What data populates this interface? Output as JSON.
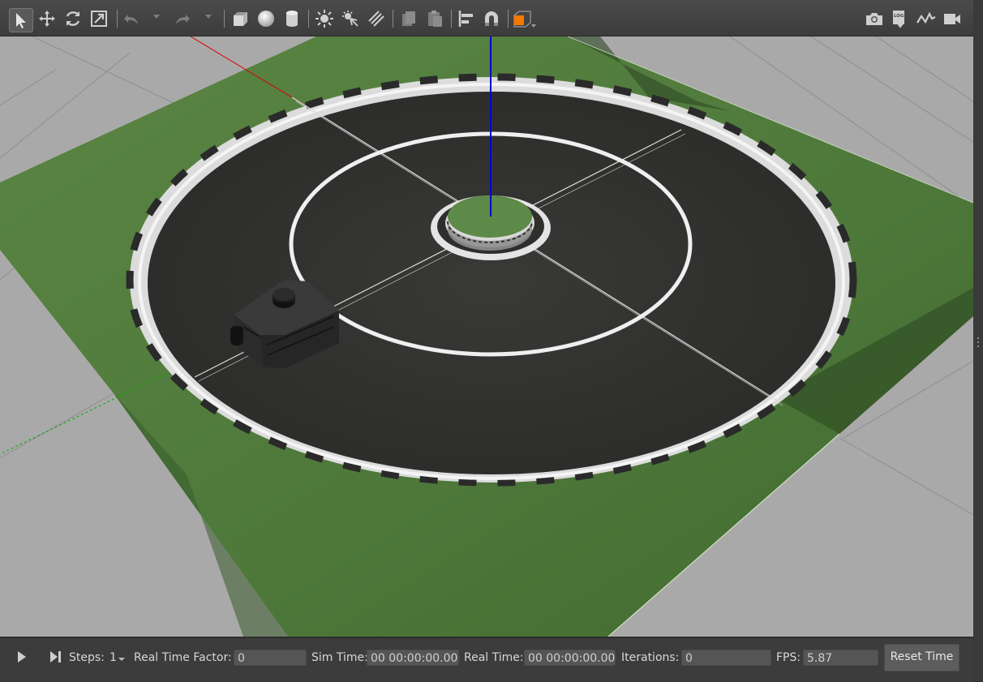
{
  "toolbar": {
    "tools": [
      {
        "name": "select-mode",
        "icon": "select-arrow-icon"
      },
      {
        "name": "translate-mode",
        "icon": "move-arrows-icon"
      },
      {
        "name": "rotate-mode",
        "icon": "rotate-icon"
      },
      {
        "name": "scale-mode",
        "icon": "scale-icon"
      },
      {
        "name": "undo",
        "icon": "undo-icon"
      },
      {
        "name": "redo",
        "icon": "redo-icon"
      },
      {
        "name": "box-shape",
        "icon": "box-icon"
      },
      {
        "name": "sphere-shape",
        "icon": "sphere-icon"
      },
      {
        "name": "cylinder-shape",
        "icon": "cylinder-icon"
      },
      {
        "name": "point-light",
        "icon": "point-light-icon"
      },
      {
        "name": "spot-light",
        "icon": "spot-light-icon"
      },
      {
        "name": "directional-light",
        "icon": "directional-light-icon"
      },
      {
        "name": "copy",
        "icon": "copy-icon"
      },
      {
        "name": "paste",
        "icon": "paste-icon"
      },
      {
        "name": "align",
        "icon": "align-icon"
      },
      {
        "name": "snap",
        "icon": "magnet-icon"
      },
      {
        "name": "view-angle",
        "icon": "view-cube-icon"
      },
      {
        "name": "screenshot",
        "icon": "camera-icon"
      },
      {
        "name": "log",
        "icon": "log-icon"
      },
      {
        "name": "plot",
        "icon": "plot-icon"
      },
      {
        "name": "record-video",
        "icon": "video-icon"
      }
    ],
    "log_icon_text": "LOG",
    "accent_color": "#f57900"
  },
  "bottom_bar": {
    "steps_label": "Steps:",
    "steps_value": "1",
    "real_time_factor_label": "Real Time Factor:",
    "real_time_factor_value": "0",
    "sim_time_label": "Sim Time:",
    "sim_time_value": "00 00:00:00.000",
    "real_time_label": "Real Time:",
    "real_time_value": "00 00:00:00.000",
    "iterations_label": "Iterations:",
    "iterations_value": "0",
    "fps_label": "FPS:",
    "fps_value": "5.87",
    "reset_time_label": "Reset Time"
  },
  "scene": {
    "background_color": "#a8a8a8",
    "ground_color": "#4f7a3a",
    "track_color": "#2e2f2d",
    "line_color": "#ececec",
    "axis_x_color": "#dd0000",
    "axis_y_color": "#00aa00",
    "axis_z_color": "#0000cc"
  }
}
